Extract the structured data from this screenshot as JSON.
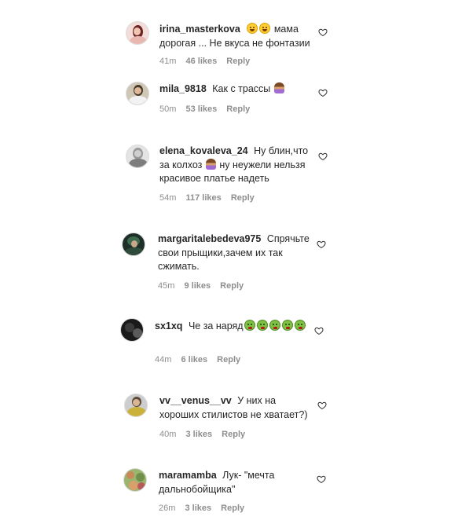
{
  "comments": [
    {
      "username": "irina_masterkova",
      "text": "мама дорогая ... Не вкуса не фонтазии",
      "time": "41m",
      "likes": "46 likes",
      "reply": "Reply",
      "avatar_colors": [
        "#f1d3cf",
        "#7b2a2a"
      ]
    },
    {
      "username": "mila_9818",
      "text": "Как с трассы",
      "time": "50m",
      "likes": "53 likes",
      "reply": "Reply",
      "avatar_colors": [
        "#d9d2c2",
        "#4a3b2a"
      ]
    },
    {
      "username": "elena_kovaleva_24",
      "text": "Ну блин,что за колхоз",
      "text2": "ну неужели нельзя красивое платье надеть",
      "time": "54m",
      "likes": "117 likes",
      "reply": "Reply",
      "avatar_colors": [
        "#e6e6e6",
        "#8a8a8a"
      ]
    },
    {
      "username": "margaritalebedeva975",
      "text": "Спрячьте свои прыщики,зачем их так сжимать.",
      "time": "45m",
      "likes": "9 likes",
      "reply": "Reply",
      "avatar_colors": [
        "#1f3b2f",
        "#6fa06b"
      ]
    },
    {
      "username": "sx1xq",
      "text": "Че за наряд",
      "time": "44m",
      "likes": "6 likes",
      "reply": "Reply",
      "avatar_colors": [
        "#1a1a1a",
        "#555555"
      ]
    },
    {
      "username": "vv__venus__vv",
      "text": "У них на хороших стилистов не хватает?)",
      "time": "40m",
      "likes": "3 likes",
      "reply": "Reply",
      "avatar_colors": [
        "#c9c9c9",
        "#c9b13a"
      ]
    },
    {
      "username": "maramamba",
      "text": "Лук- \"мечта дальнобойщика\"",
      "time": "26m",
      "likes": "3 likes",
      "reply": "Reply",
      "avatar_colors": [
        "#8fb06b",
        "#c9855a"
      ]
    }
  ],
  "icons": {
    "heart": "heart-outline-icon",
    "laugh": "face-with-tears-of-joy-icon",
    "person": "person-gesturing-no-icon",
    "sick": "nauseated-face-icon"
  }
}
